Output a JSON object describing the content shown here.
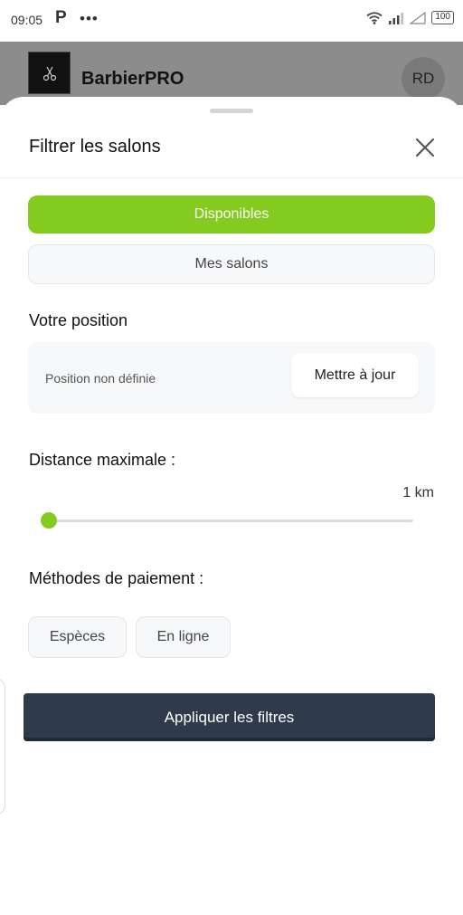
{
  "status_bar": {
    "time": "09:05",
    "app_indicator": "P",
    "dots": "•••",
    "battery": "100"
  },
  "app_header": {
    "title": "BarbierPRO",
    "avatar_initials": "RD",
    "logo_icon": "scissors-icon"
  },
  "sheet": {
    "title": "Filtrer les salons",
    "close_icon": "close-icon",
    "tabs": {
      "available_label": "Disponibles",
      "my_salons_label": "Mes salons"
    },
    "position": {
      "label": "Votre position",
      "status": "Position non définie",
      "update_label": "Mettre à jour"
    },
    "distance": {
      "label": "Distance maximale :",
      "value_text": "1 km",
      "value_km": 1,
      "slider_fraction": 0
    },
    "payment": {
      "label": "Méthodes de paiement :",
      "options": [
        "Espèces",
        "En ligne"
      ]
    },
    "apply_label": "Appliquer les filtres"
  },
  "colors": {
    "accent_green": "#83cc1f",
    "apply_dark": "#2f3a4b",
    "overlay_header": "#8c8c8c"
  }
}
